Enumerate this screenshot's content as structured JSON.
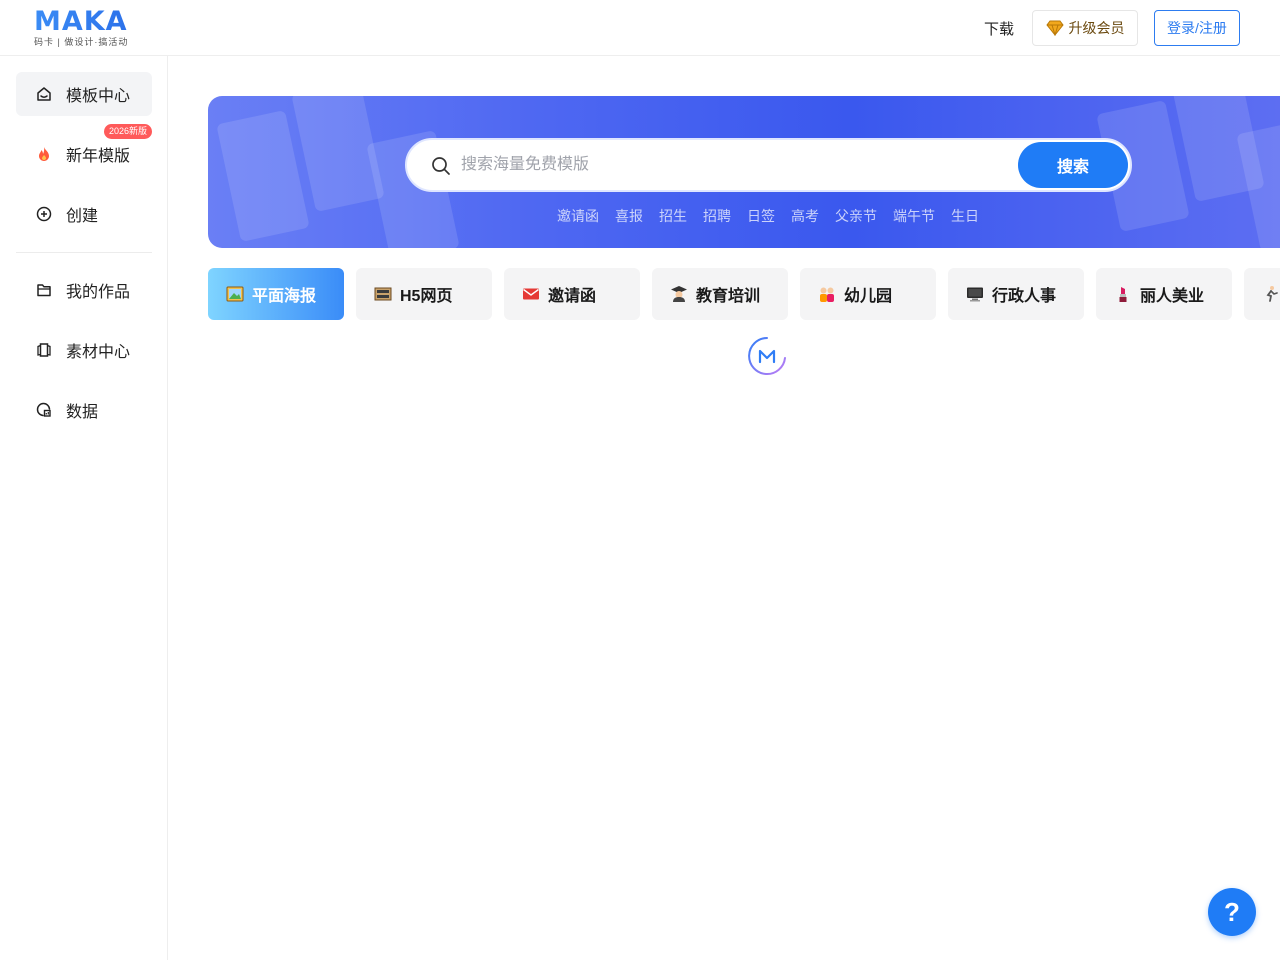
{
  "header": {
    "logo_text": "MAKA",
    "logo_sub": "码卡 | 做设计·搞活动",
    "download_label": "下载",
    "vip_label": "升级会员",
    "login_label": "登录/注册"
  },
  "sidebar": {
    "items": [
      {
        "label": "模板中心",
        "icon": "home-icon",
        "active": true
      },
      {
        "label": "新年模版",
        "icon": "fire-icon",
        "badge": "2026新版"
      },
      {
        "label": "创建",
        "icon": "plus-circle-icon"
      },
      {
        "label": "我的作品",
        "icon": "folder-icon"
      },
      {
        "label": "素材中心",
        "icon": "book-icon"
      },
      {
        "label": "数据",
        "icon": "chart-icon"
      }
    ]
  },
  "search": {
    "placeholder": "搜索海量免费模版",
    "button_label": "搜索",
    "hot_tags": [
      "邀请函",
      "喜报",
      "招生",
      "招聘",
      "日签",
      "高考",
      "父亲节",
      "端午节",
      "生日"
    ]
  },
  "categories": [
    {
      "label": "平面海报",
      "icon": "poster-icon",
      "active": true
    },
    {
      "label": "H5网页",
      "icon": "film-icon"
    },
    {
      "label": "邀请函",
      "icon": "envelope-icon"
    },
    {
      "label": "教育培训",
      "icon": "graduate-icon"
    },
    {
      "label": "幼儿园",
      "icon": "kids-icon"
    },
    {
      "label": "行政人事",
      "icon": "monitor-icon"
    },
    {
      "label": "丽人美业",
      "icon": "lipstick-icon"
    },
    {
      "label": "",
      "icon": "runner-icon"
    }
  ],
  "colors": {
    "brand": "#1f7cf6",
    "badge": "#ff5a5a",
    "banner": "#4f68f2"
  },
  "help_label": "?"
}
